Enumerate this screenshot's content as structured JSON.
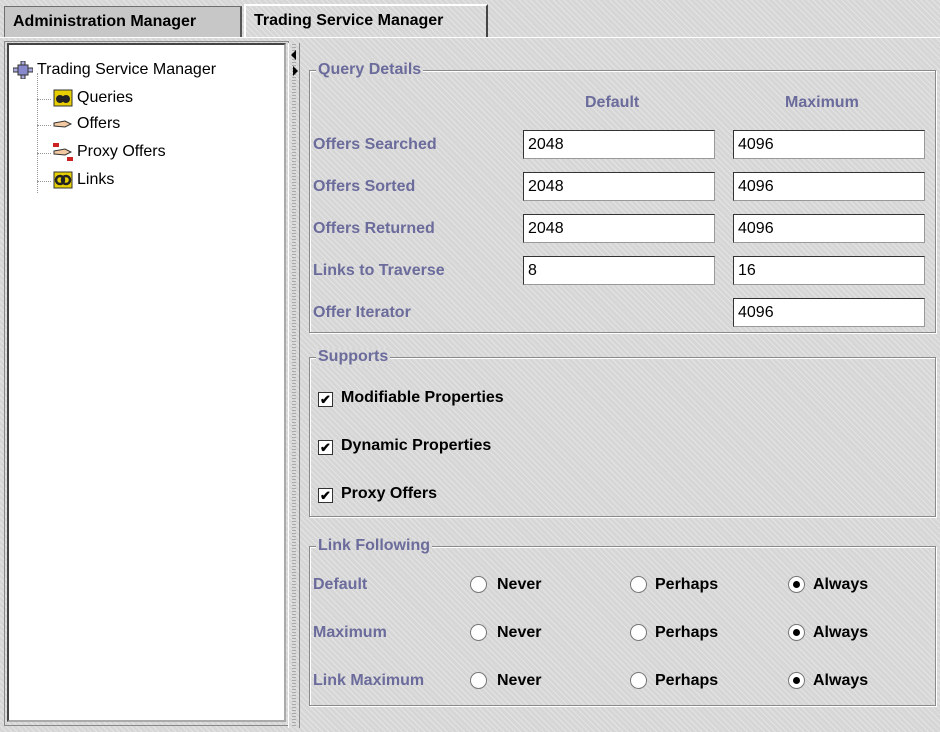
{
  "tabs": {
    "admin": "Administration Manager",
    "trading": "Trading Service Manager"
  },
  "tree": {
    "root": "Trading Service Manager",
    "items": [
      "Queries",
      "Offers",
      "Proxy Offers",
      "Links"
    ]
  },
  "query_details": {
    "title": "Query Details",
    "col_default": "Default",
    "col_maximum": "Maximum",
    "rows": [
      {
        "label": "Offers Searched",
        "default": "2048",
        "maximum": "4096"
      },
      {
        "label": "Offers Sorted",
        "default": "2048",
        "maximum": "4096"
      },
      {
        "label": "Offers Returned",
        "default": "2048",
        "maximum": "4096"
      },
      {
        "label": "Links to Traverse",
        "default": "8",
        "maximum": "16"
      },
      {
        "label": "Offer Iterator",
        "maximum": "4096"
      }
    ]
  },
  "supports": {
    "title": "Supports",
    "check_mark": "✔",
    "items": [
      {
        "label": "Modifiable Properties",
        "checked": true
      },
      {
        "label": "Dynamic Properties",
        "checked": true
      },
      {
        "label": "Proxy Offers",
        "checked": true
      }
    ]
  },
  "link_following": {
    "title": "Link Following",
    "options": [
      "Never",
      "Perhaps",
      "Always"
    ],
    "rows": [
      {
        "label": "Default",
        "selected": "Always"
      },
      {
        "label": "Maximum",
        "selected": "Always"
      },
      {
        "label": "Link Maximum",
        "selected": "Always"
      }
    ]
  },
  "colors": {
    "label": "#6b6b9c"
  }
}
